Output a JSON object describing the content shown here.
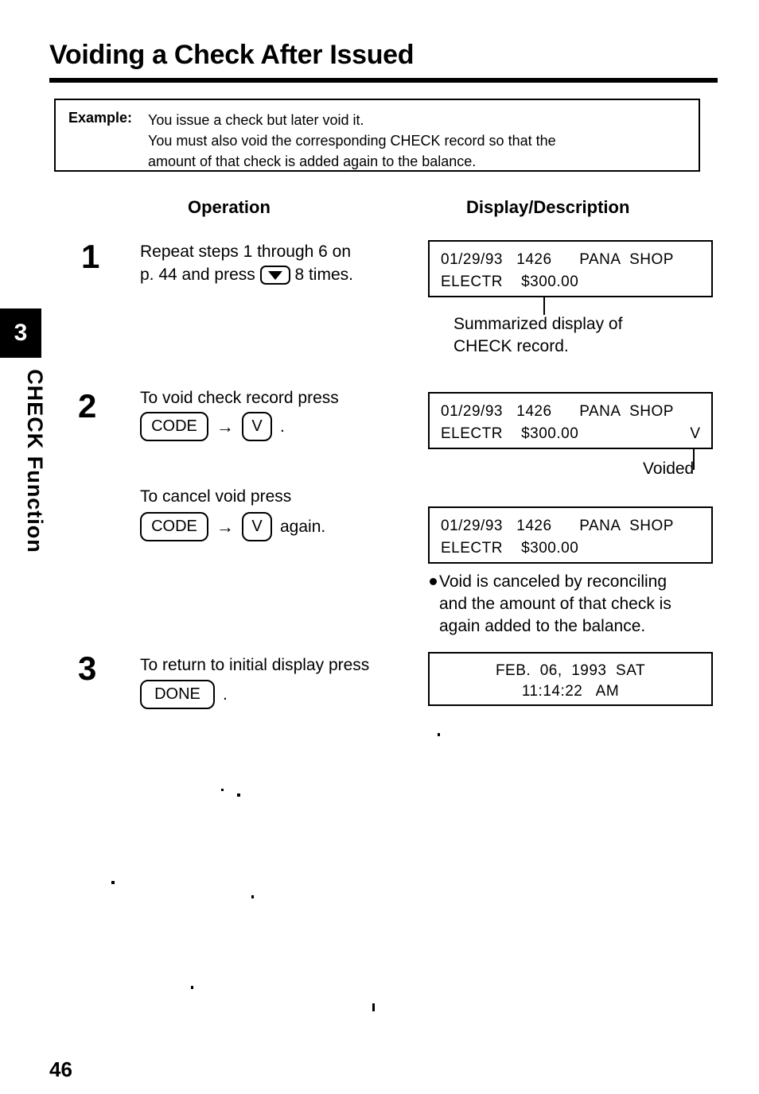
{
  "page": {
    "title": "Voiding a Check After Issued",
    "number": "46"
  },
  "side_tab": {
    "chapter_number": "3",
    "chapter_label": "CHECK Function"
  },
  "example": {
    "label": "Example:",
    "lines": [
      "You issue a check but later void it.",
      "You must also void the corresponding CHECK record so that the",
      "amount of that check is added again to the balance."
    ]
  },
  "columns": {
    "operation": "Operation",
    "display_description": "Display/Description"
  },
  "steps": [
    {
      "number": "1",
      "operation_line1": "Repeat steps 1 through 6 on",
      "operation_line2_pre": "p. 44 and press",
      "operation_line2_post": "8 times.",
      "key_icon": "down-arrow-key"
    },
    {
      "number": "2",
      "operation_line1": "To void check record press",
      "key_first": "CODE",
      "key_arrow": "→",
      "key_second": "V",
      "trailing": ".",
      "cancel_line": "To cancel void press",
      "cancel_key_first": "CODE",
      "cancel_key_arrow": "→",
      "cancel_key_second": "V",
      "cancel_trailing": "again."
    },
    {
      "number": "3",
      "operation_line1": "To return to initial display press",
      "key_first": "DONE",
      "trailing": "."
    }
  ],
  "displays": {
    "step1": {
      "line1": "01/29/93   1426      PANA  SHOP",
      "line2": "ELECTR    $300.00"
    },
    "step2_voided": {
      "line1": "01/29/93   1426      PANA  SHOP",
      "line2": "ELECTR    $300.00",
      "void_marker": "V"
    },
    "step2_cancelled": {
      "line1": "01/29/93   1426      PANA  SHOP",
      "line2": "ELECTR    $300.00"
    },
    "step3_initial": {
      "line1": "FEB.  06,  1993  SAT",
      "line2": "11:14:22   AM"
    }
  },
  "annotations": {
    "summarized_line1": "Summarized display of",
    "summarized_line2": "CHECK record.",
    "voided": "Voided",
    "bullet_line1": "Void is canceled by reconciling",
    "bullet_line2": "and the amount of that check is",
    "bullet_line3": "again added to the balance."
  }
}
